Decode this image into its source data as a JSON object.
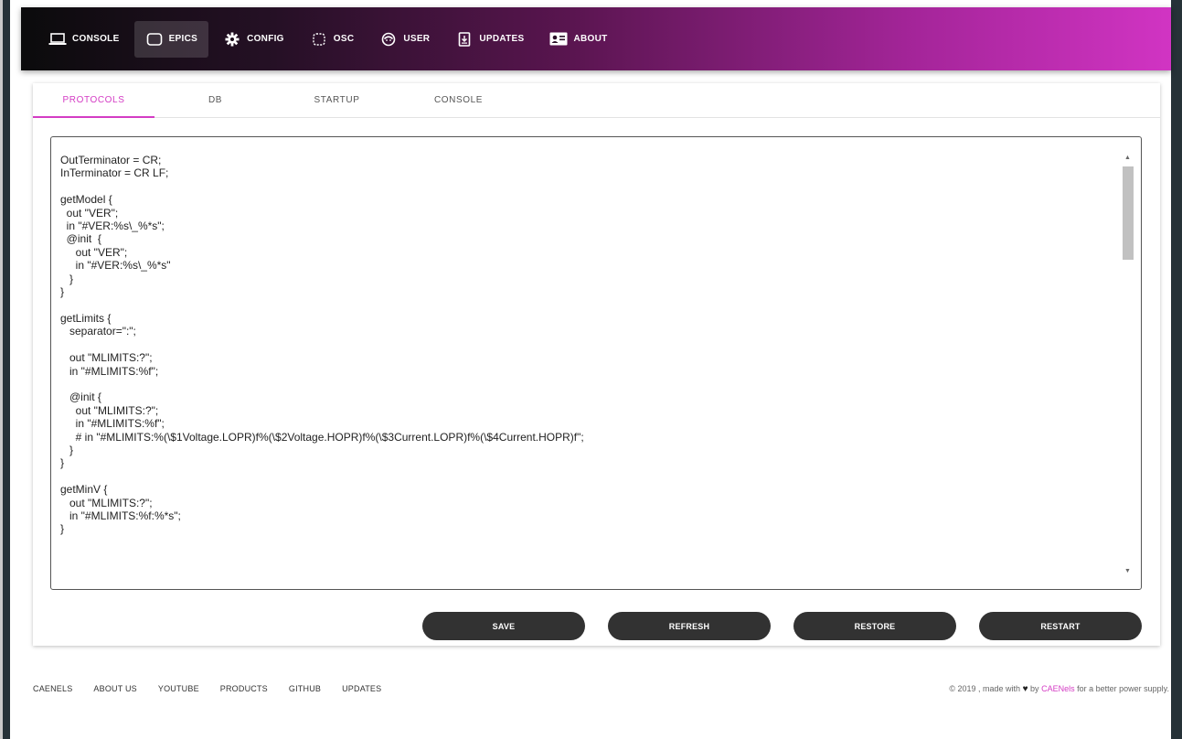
{
  "nav": {
    "items": [
      {
        "label": "CONSOLE",
        "icon": "laptop-icon"
      },
      {
        "label": "EPICS",
        "icon": "square-icon"
      },
      {
        "label": "CONFIG",
        "icon": "gear-icon"
      },
      {
        "label": "OSC",
        "icon": "oscilloscope-icon"
      },
      {
        "label": "USER",
        "icon": "user-icon"
      },
      {
        "label": "UPDATES",
        "icon": "download-icon"
      },
      {
        "label": "ABOUT",
        "icon": "id-card-icon"
      }
    ],
    "active": "EPICS"
  },
  "tabs": [
    "PROTOCOLS",
    "DB",
    "STARTUP",
    "CONSOLE"
  ],
  "active_tab": "PROTOCOLS",
  "editor": {
    "content": "OutTerminator = CR;\nInTerminator = CR LF;\n\ngetModel {\n  out \"VER\";\n  in \"#VER:%s\\_%*s\";\n  @init  {\n     out \"VER\";\n     in \"#VER:%s\\_%*s\"\n   }\n}\n\ngetLimits {\n   separator=\":\";\n\n   out \"MLIMITS:?\";\n   in \"#MLIMITS:%f\";\n\n   @init {\n     out \"MLIMITS:?\";\n     in \"#MLIMITS:%f\";\n     # in \"#MLIMITS:%(\\$1Voltage.LOPR)f%(\\$2Voltage.HOPR)f%(\\$3Current.LOPR)f%(\\$4Current.HOPR)f\";\n   }\n}\n\ngetMinV {\n   out \"MLIMITS:?\";\n   in \"#MLIMITS:%f:%*s\";\n}"
  },
  "buttons": {
    "save": "SAVE",
    "refresh": "REFRESH",
    "restore": "RESTORE",
    "restart": "RESTART"
  },
  "footer": {
    "links": [
      "CAENELS",
      "ABOUT US",
      "YOUTUBE",
      "PRODUCTS",
      "GITHUB",
      "UPDATES"
    ],
    "copyright_pre": "© 2019 , made with",
    "by": "by",
    "brand": "CAENels",
    "copyright_post": "for a better power supply."
  },
  "colors": {
    "accent": "#d43cc4",
    "button": "#323232"
  }
}
